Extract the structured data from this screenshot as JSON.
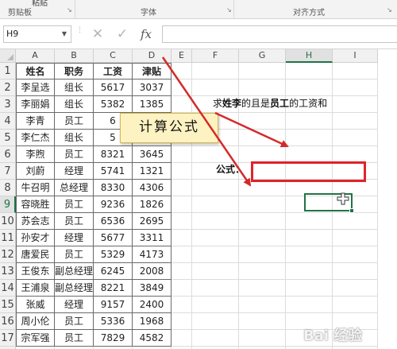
{
  "ribbon": {
    "partial": "粘贴",
    "clipboard": "剪贴板",
    "font": "字体",
    "alignment": "对齐方式"
  },
  "formula_bar": {
    "name_box": "H9",
    "cancel_glyph": "✕",
    "enter_glyph": "✓",
    "fx_label": "fx",
    "formula": ""
  },
  "columns": [
    "A",
    "B",
    "C",
    "D",
    "E",
    "F",
    "G",
    "H",
    "I"
  ],
  "selected_column": "H",
  "rows": [
    "1",
    "2",
    "3",
    "4",
    "5",
    "6",
    "7",
    "8",
    "9",
    "10",
    "11",
    "12",
    "13",
    "14",
    "15",
    "16",
    "17",
    "18"
  ],
  "selected_row": "9",
  "table": {
    "headers": [
      "姓名",
      "职务",
      "工资",
      "津贴"
    ],
    "rows": [
      [
        "李呈选",
        "组长",
        "5617",
        "3037"
      ],
      [
        "李丽娟",
        "组长",
        "5382",
        "1385"
      ],
      [
        "李青",
        "员工",
        "6",
        ""
      ],
      [
        "李仁杰",
        "组长",
        "5",
        ""
      ],
      [
        "李煦",
        "员工",
        "8321",
        "3645"
      ],
      [
        "刘蔚",
        "经理",
        "5741",
        "1321"
      ],
      [
        "牛召明",
        "总经理",
        "8330",
        "4306"
      ],
      [
        "容晓胜",
        "员工",
        "9236",
        "1826"
      ],
      [
        "苏会志",
        "员工",
        "6536",
        "2695"
      ],
      [
        "孙安才",
        "经理",
        "5677",
        "3311"
      ],
      [
        "唐爱民",
        "员工",
        "5329",
        "4173"
      ],
      [
        "王俊东",
        "副总经理",
        "6245",
        "2008"
      ],
      [
        "王浦泉",
        "副总经理",
        "8221",
        "3849"
      ],
      [
        "张威",
        "经理",
        "9157",
        "2400"
      ],
      [
        "周小伦",
        "员工",
        "5336",
        "1968"
      ],
      [
        "宗军强",
        "员工",
        "7829",
        "4582"
      ]
    ]
  },
  "question": {
    "p1": "求",
    "p2": "姓李",
    "p3": "的且是",
    "p4": "员工",
    "p5": "的工资和"
  },
  "formula_label": "公式：",
  "callout": "计算公式",
  "watermark": "Bai 经验",
  "colors": {
    "accent_green": "#217346",
    "annotation_red": "#e0232c",
    "callout_fill": "#fdf3c2"
  }
}
